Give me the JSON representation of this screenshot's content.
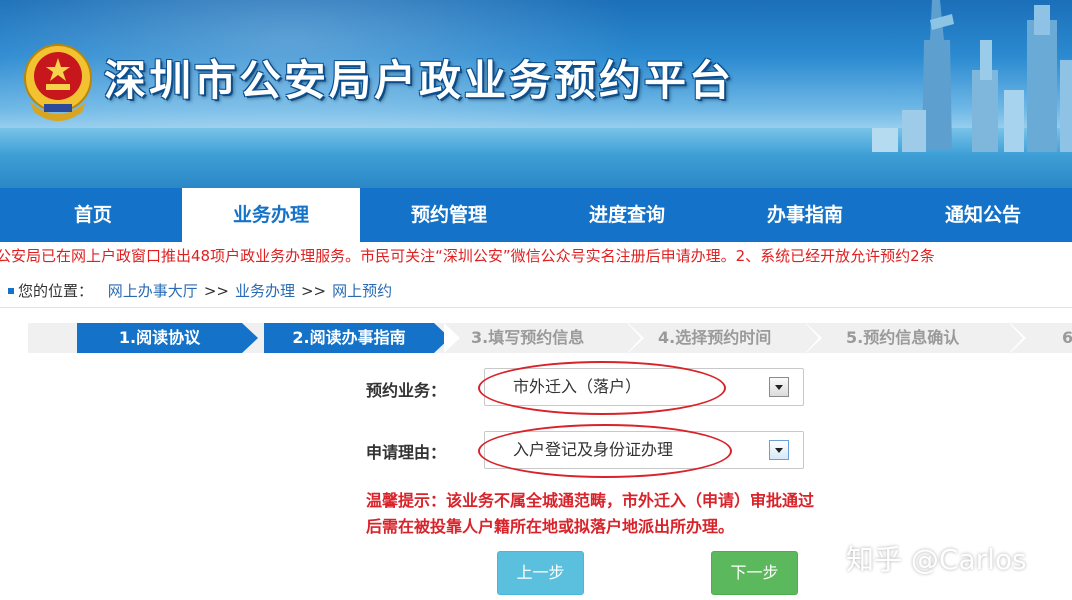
{
  "header": {
    "title": "深圳市公安局户政业务预约平台"
  },
  "nav": {
    "items": [
      {
        "label": "首页"
      },
      {
        "label": "业务办理",
        "active": true
      },
      {
        "label": "预约管理"
      },
      {
        "label": "进度查询"
      },
      {
        "label": "办事指南"
      },
      {
        "label": "通知公告"
      }
    ]
  },
  "notice": {
    "text": "公安局已在网上户政窗口推出48项户政业务办理服务。市民可关注“深圳公安”微信公众号实名注册后申请办理。2、系统已经开放允许预约2条"
  },
  "breadcrumb": {
    "prefix": "您的位置：",
    "items": [
      "网上办事大厅",
      "业务办理",
      "网上预约"
    ],
    "separator": ">>"
  },
  "steps": {
    "items": [
      {
        "label": "1.阅读协议",
        "state": "done"
      },
      {
        "label": "2.阅读办事指南",
        "state": "current"
      },
      {
        "label": "3.填写预约信息",
        "state": "pending"
      },
      {
        "label": "4.选择预约时间",
        "state": "pending"
      },
      {
        "label": "5.预约信息确认",
        "state": "pending"
      },
      {
        "label": "6",
        "state": "pending"
      }
    ]
  },
  "form": {
    "business": {
      "label": "预约业务：",
      "value": "市外迁入（落户）"
    },
    "reason": {
      "label": "申请理由：",
      "value": "入户登记及身份证办理"
    },
    "tip_line1": "温馨提示：该业务不属全城通范畴，市外迁入（申请）审批通过",
    "tip_line2": "后需在被投靠人户籍所在地或拟落户地派出所办理。"
  },
  "buttons": {
    "prev": "上一步",
    "next": "下一步"
  },
  "watermark": "知乎 @Carlos",
  "colors": {
    "nav_blue": "#1472c8",
    "alert_red": "#d9232a",
    "prev_button": "#5bc0de",
    "next_button": "#5cb85c"
  }
}
